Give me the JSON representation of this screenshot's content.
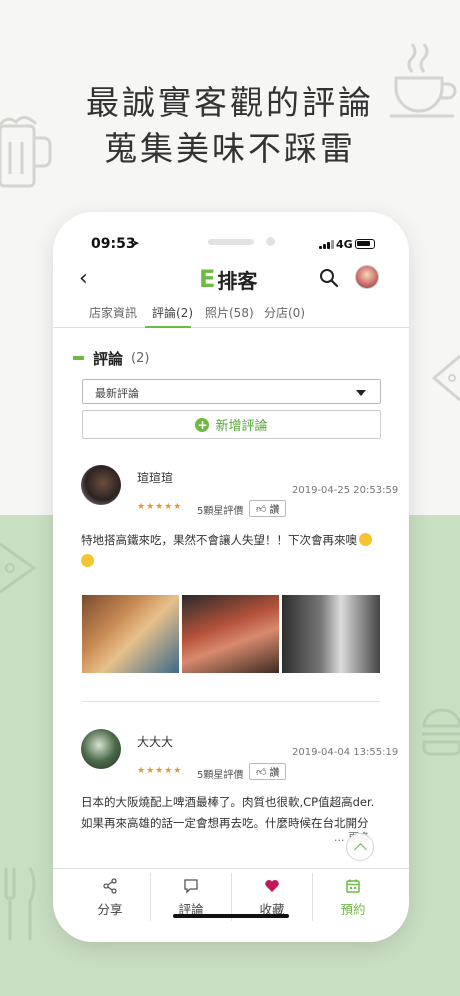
{
  "promo": {
    "line1": "最誠實客觀的評論",
    "line2": "蒐集美味不踩雷"
  },
  "status_bar": {
    "time": "09:53",
    "network": "4G"
  },
  "navbar": {
    "back_icon": "chevron-left-icon",
    "brand_e": "E",
    "brand_name": "排客",
    "search_icon": "search-icon"
  },
  "tabs": [
    {
      "label": "店家資訊",
      "active": false
    },
    {
      "label": "評論(2)",
      "active": true
    },
    {
      "label": "照片(58)",
      "active": false
    },
    {
      "label": "分店(0)",
      "active": false
    }
  ],
  "section": {
    "title": "評論",
    "count": "(2)"
  },
  "sort": {
    "selected": "最新評論"
  },
  "add_review": {
    "label": "新增評論"
  },
  "reviews": [
    {
      "name": "瑄瑄瑄",
      "date": "2019-04-25 20:53:59",
      "stars": "★★★★★",
      "rating_text": "5顆星評價",
      "like_label": "讚",
      "text": "特地搭高鐵來吃，果然不會讓人失望！！下次會再來噢"
    },
    {
      "name": "大大大",
      "date": "2019-04-04 13:55:19",
      "stars": "★★★★★",
      "rating_text": "5顆星評價",
      "like_label": "讚",
      "text_line1": "日本的大阪燒配上啤酒最棒了。肉質也很軟,CP值超高der.",
      "text_line2": "如果再來高雄的話一定會想再去吃。什麼時候在台北開分",
      "more": "... 更多"
    }
  ],
  "bottom_bar": [
    {
      "label": "分享",
      "icon": "share-icon"
    },
    {
      "label": "評論",
      "icon": "comment-icon"
    },
    {
      "label": "收藏",
      "icon": "heart-icon"
    },
    {
      "label": "預約",
      "icon": "calendar-icon"
    }
  ],
  "colors": {
    "accent": "#6dbb43",
    "heart": "#c2185b",
    "background_bottom": "#c9dfc2"
  }
}
